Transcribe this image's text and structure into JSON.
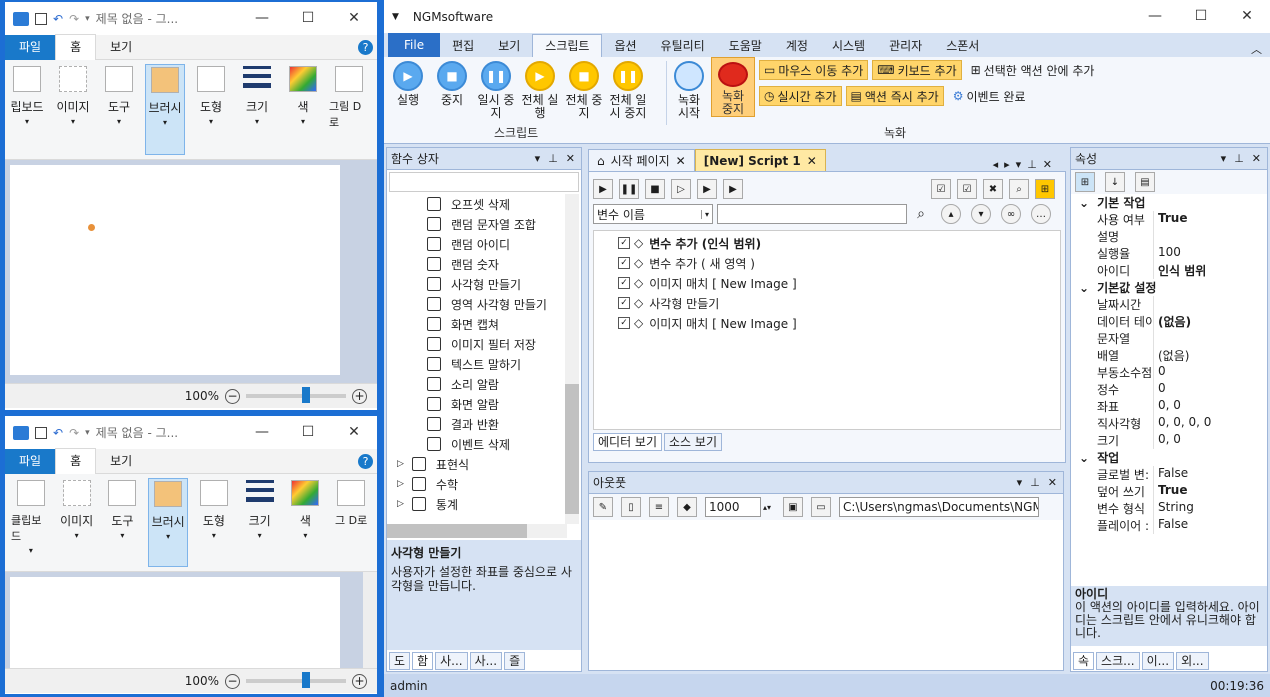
{
  "paint_top": {
    "title": "제목 없음 - 그...",
    "tabs": [
      "파일",
      "홈",
      "보기"
    ],
    "groups": [
      "클립보드",
      "이미지",
      "도구",
      "브러시",
      "도형",
      "크기",
      "색",
      "그림 D로"
    ],
    "zoom": "100%"
  },
  "paint_top_first_tool_label": "립보드",
  "paint_bottom": {
    "title": "제목 없음 - 그...",
    "tabs": [
      "파일",
      "홈",
      "보기"
    ],
    "groups": [
      "클립보드",
      "이미지",
      "도구",
      "브러시",
      "도형",
      "크기",
      "색",
      "그 D로"
    ],
    "zoom": "100%"
  },
  "ngm": {
    "title": "NGMsoftware",
    "tabs": [
      "File",
      "편집",
      "보기",
      "스크립트",
      "옵션",
      "유틸리티",
      "도움말",
      "계정",
      "시스템",
      "관리자",
      "스폰서"
    ],
    "ribbon_script": {
      "buttons": [
        {
          "label": "실행",
          "color": "blue",
          "glyph": "▶"
        },
        {
          "label": "중지",
          "color": "blue",
          "glyph": "■"
        },
        {
          "label": "일시 중지",
          "color": "blue",
          "glyph": "❚❚"
        },
        {
          "label": "전체 실행",
          "color": "yel",
          "glyph": "▶"
        },
        {
          "label": "전체 중지",
          "color": "yel",
          "glyph": "■"
        },
        {
          "label": "전체 일시 중지",
          "color": "yel",
          "glyph": "❚❚"
        }
      ],
      "group_label": "스크립트"
    },
    "ribbon_record": {
      "record_start": "녹화 시작",
      "record_stop": "녹화 중지",
      "mouse_move": "마우스 이동 추가",
      "keyboard": "키보드 추가",
      "realtime": "실시간 추가",
      "action_now": "액션 즉시 추가",
      "add_in_selected": "선택한 액션 안에 추가",
      "event_done": "이벤트 완료",
      "group_label": "녹화"
    },
    "function_box": {
      "title": "함수 상자",
      "items": [
        "오프셋 삭제",
        "랜덤 문자열 조합",
        "랜덤 아이디",
        "랜덤 숫자",
        "사각형 만들기",
        "영역 사각형 만들기",
        "화면 캡쳐",
        "이미지 필터 저장",
        "텍스트 말하기",
        "소리 알람",
        "화면 알람",
        "결과 반환",
        "이벤트 삭제"
      ],
      "groups": [
        "표현식",
        "수학",
        "통계"
      ],
      "desc_title": "사각형 만들기",
      "desc_text": "사용자가 설정한 좌표를 중심으로 사각형을 만듭니다.",
      "bottom_tabs": [
        "도",
        "함",
        "사...",
        "사...",
        "즐"
      ]
    },
    "doc_tabs": [
      "시작 페이지",
      "[New] Script 1"
    ],
    "editor": {
      "var_select": "변수 이름",
      "rows": [
        {
          "text": "변수 추가 (인식 범위)",
          "bold": true
        },
        {
          "text": "변수 추가 ( 새 영역 )",
          "bold": false
        },
        {
          "text": "이미지 매치 [ New Image ]",
          "bold": false
        },
        {
          "text": "사각형 만들기",
          "bold": false
        },
        {
          "text": "이미지 매치 [ New Image ]",
          "bold": false
        }
      ],
      "bottom_tabs": [
        "에디터 보기",
        "소스 보기"
      ]
    },
    "output": {
      "title": "아웃풋",
      "count": "1000",
      "path": "C:\\Users\\ngmas\\Documents\\NGM6\\"
    },
    "properties": {
      "title": "속성",
      "cats": [
        {
          "name": "기본 작업",
          "rows": [
            [
              "사용 여부",
              "True"
            ],
            [
              "설명",
              ""
            ],
            [
              "실행율",
              "100"
            ],
            [
              "아이디",
              "인식 범위"
            ]
          ]
        },
        {
          "name": "기본값 설정",
          "rows": [
            [
              "날짜시간",
              ""
            ],
            [
              "데이터 테이",
              "(없음)"
            ],
            [
              "문자열",
              ""
            ],
            [
              "배열",
              "(없음)"
            ],
            [
              "부동소수점",
              "0"
            ],
            [
              "정수",
              "0"
            ],
            [
              "좌표",
              "0, 0"
            ],
            [
              "직사각형",
              "0, 0, 0, 0"
            ],
            [
              "크기",
              "0, 0"
            ]
          ]
        },
        {
          "name": "작업",
          "rows": [
            [
              "글로벌 변:",
              "False"
            ],
            [
              "덮어 쓰기",
              "True"
            ],
            [
              "변수 형식",
              "String"
            ],
            [
              "플레이어 :",
              "False"
            ]
          ]
        }
      ],
      "desc_title": "아이디",
      "desc_text": "이 액션의 아이디를 입력하세요. 아이디는 스크립트 안에서 유니크해야 합니다.",
      "bottom_tabs": [
        "속",
        "스크...",
        "이...",
        "외..."
      ]
    },
    "status_user": "admin",
    "status_time": "00:19:36"
  }
}
